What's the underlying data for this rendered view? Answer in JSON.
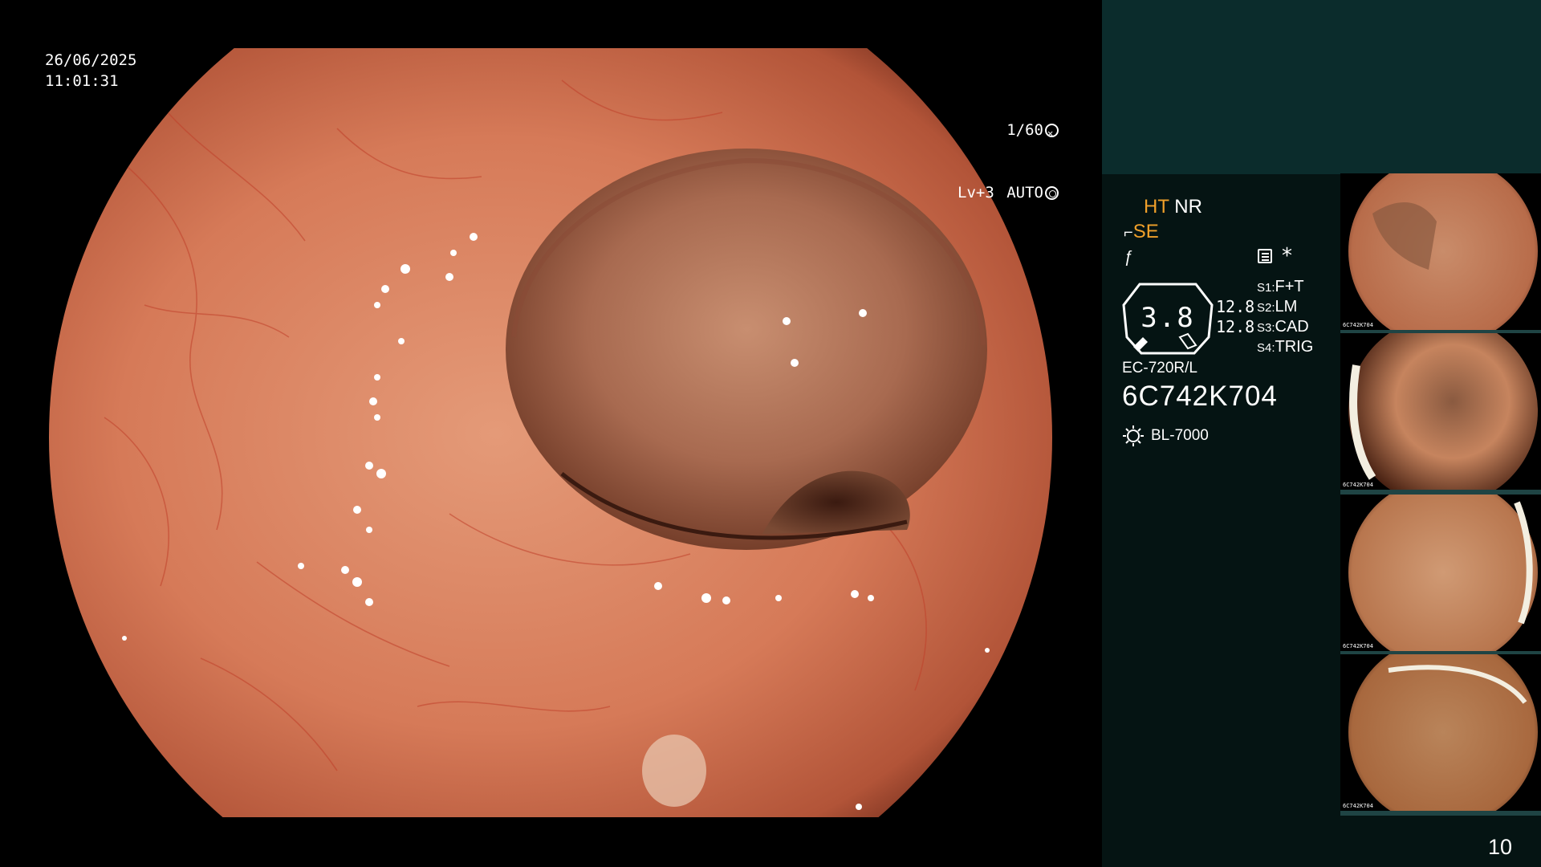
{
  "overlay": {
    "date": "26/06/2025",
    "time": "11:01:31",
    "shutter": "1/60",
    "level": "Lv+3",
    "mode": "AUTO"
  },
  "panel": {
    "ht": "HT",
    "nr": "NR",
    "se": "SE",
    "gauge_value": "3.8",
    "side_values": [
      "12.8",
      "12.8"
    ],
    "switches": [
      {
        "key": "S1:",
        "value": "F+T"
      },
      {
        "key": "S2:",
        "value": "LM"
      },
      {
        "key": "S3:",
        "value": "CAD"
      },
      {
        "key": "S4:",
        "value": "TRIG"
      }
    ],
    "scope_model": "EC-720R/L",
    "scope_serial": "6C742K704",
    "light_source": "BL-7000"
  },
  "thumbnails": [
    {
      "caption": "6C742K704"
    },
    {
      "caption": "6C742K704"
    },
    {
      "caption": "6C742K704"
    },
    {
      "caption": "6C742K704"
    }
  ],
  "page_number": "10",
  "colors": {
    "panel_bg": "#051413",
    "panel_top": "#0b2c2c",
    "accent_orange": "#f0a02a",
    "mucosa": "#c96a4c"
  }
}
